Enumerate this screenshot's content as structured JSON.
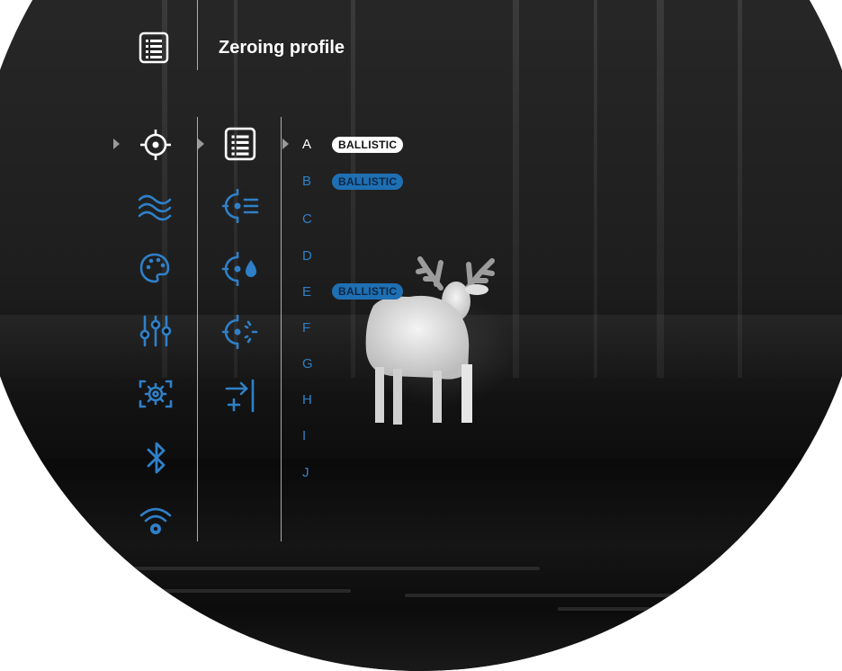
{
  "header": {
    "title": "Zeroing profile",
    "icon": "profile-list-icon"
  },
  "colors": {
    "accent": "#2f80c8",
    "active": "#ffffff",
    "badge_dim": "#1f6fb3"
  },
  "main_menu": [
    {
      "name": "crosshair-icon",
      "active": true
    },
    {
      "name": "waves-icon",
      "active": false
    },
    {
      "name": "palette-icon",
      "active": false
    },
    {
      "name": "sliders-icon",
      "active": false
    },
    {
      "name": "settings-frame-icon",
      "active": false
    },
    {
      "name": "bluetooth-icon",
      "active": false
    },
    {
      "name": "wifi-settings-icon",
      "active": false
    }
  ],
  "submenu": [
    {
      "name": "profile-list-icon",
      "active": true
    },
    {
      "name": "reticle-list-icon",
      "active": false
    },
    {
      "name": "reticle-drop-icon",
      "active": false
    },
    {
      "name": "reticle-sun-icon",
      "active": false
    },
    {
      "name": "add-distance-icon",
      "active": false
    }
  ],
  "profiles": [
    {
      "letter": "A",
      "badge": "BALLISTIC",
      "active": true
    },
    {
      "letter": "B",
      "badge": "BALLISTIC",
      "active": false
    },
    {
      "letter": "C",
      "badge": "",
      "active": false
    },
    {
      "letter": "D",
      "badge": "",
      "active": false
    },
    {
      "letter": "E",
      "badge": "BALLISTIC",
      "active": false
    },
    {
      "letter": "F",
      "badge": "",
      "active": false
    },
    {
      "letter": "G",
      "badge": "",
      "active": false
    },
    {
      "letter": "H",
      "badge": "",
      "active": false
    },
    {
      "letter": "I",
      "badge": "",
      "active": false
    },
    {
      "letter": "J",
      "badge": "",
      "active": false
    }
  ]
}
